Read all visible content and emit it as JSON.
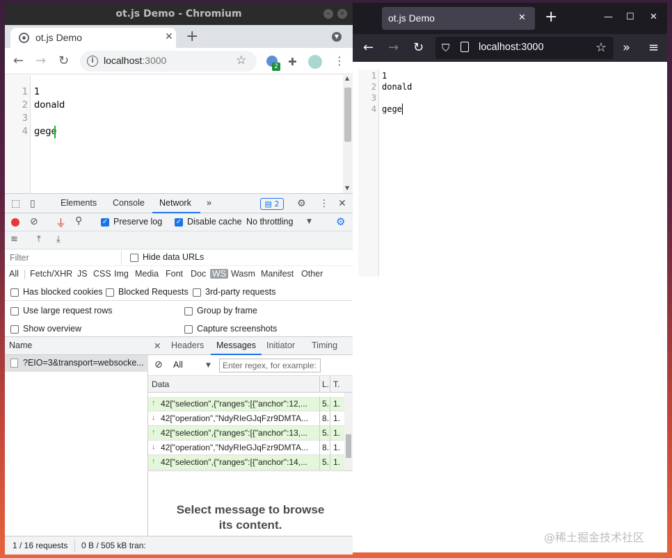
{
  "chromium": {
    "window_title": "ot.js Demo - Chromium",
    "tab_title": "ot.js Demo",
    "url_host": "localhost",
    "url_port": ":3000",
    "ext_badge": "2",
    "editor_lines": [
      {
        "num": "1",
        "text": "1"
      },
      {
        "num": "2",
        "text": "donald"
      },
      {
        "num": "3",
        "text": ""
      },
      {
        "num": "4",
        "text": "gege"
      }
    ],
    "devtools": {
      "tabs": [
        "Elements",
        "Console",
        "Network"
      ],
      "more": "»",
      "issues_count": "2",
      "preserve_log": "Preserve log",
      "disable_cache": "Disable cache",
      "throttling": "No throttling",
      "filter_placeholder": "Filter",
      "hide_data_urls": "Hide data URLs",
      "types": [
        "All",
        "Fetch/XHR",
        "JS",
        "CSS",
        "Img",
        "Media",
        "Font",
        "Doc",
        "WS",
        "Wasm",
        "Manifest",
        "Other"
      ],
      "has_blocked_cookies": "Has blocked cookies",
      "blocked_requests": "Blocked Requests",
      "third_party": "3rd-party requests",
      "large_rows": "Use large request rows",
      "group_by_frame": "Group by frame",
      "show_overview": "Show overview",
      "capture_screenshots": "Capture screenshots",
      "name_header": "Name",
      "request_name": "?EIO=3&transport=websocke...",
      "detail_tabs": [
        "Headers",
        "Messages",
        "Initiator",
        "Timing"
      ],
      "msg_filter_value": "All",
      "regex_placeholder": "Enter regex, for example:",
      "col_data": "Data",
      "col_len": "L.",
      "col_time": "T.",
      "messages": [
        {
          "dir": "up",
          "data": "42[\"selection\",{\"ranges\":[{\"anchor\":12,...",
          "len": "5.",
          "time": "1."
        },
        {
          "dir": "down",
          "data": "42[\"operation\",\"NdyRIeGJqFzr9DMTA...",
          "len": "8.",
          "time": "1."
        },
        {
          "dir": "up",
          "data": "42[\"selection\",{\"ranges\":[{\"anchor\":13,...",
          "len": "5.",
          "time": "1."
        },
        {
          "dir": "down",
          "data": "42[\"operation\",\"NdyRIeGJqFzr9DMTA...",
          "len": "8.",
          "time": "1."
        },
        {
          "dir": "up",
          "data": "42[\"selection\",{\"ranges\":[{\"anchor\":14,...",
          "len": "5.",
          "time": "1."
        }
      ],
      "browse_text": "Select message to browse its content.",
      "status_requests": "1 / 16 requests",
      "status_transfer": "0 B / 505 kB tran:"
    }
  },
  "firefox": {
    "tab_title": "ot.js Demo",
    "url": "localhost:3000",
    "editor_lines": [
      {
        "num": "1",
        "text": "1"
      },
      {
        "num": "2",
        "text": "donald"
      },
      {
        "num": "3",
        "text": ""
      },
      {
        "num": "4",
        "text": "gege"
      }
    ]
  },
  "watermark": "@稀土掘金技术社区",
  "colors": {
    "accent": "#1a73e8",
    "record_red": "#e53935",
    "ws_up_bg": "#e4f7da",
    "cursor_green": "#1bb51b"
  }
}
